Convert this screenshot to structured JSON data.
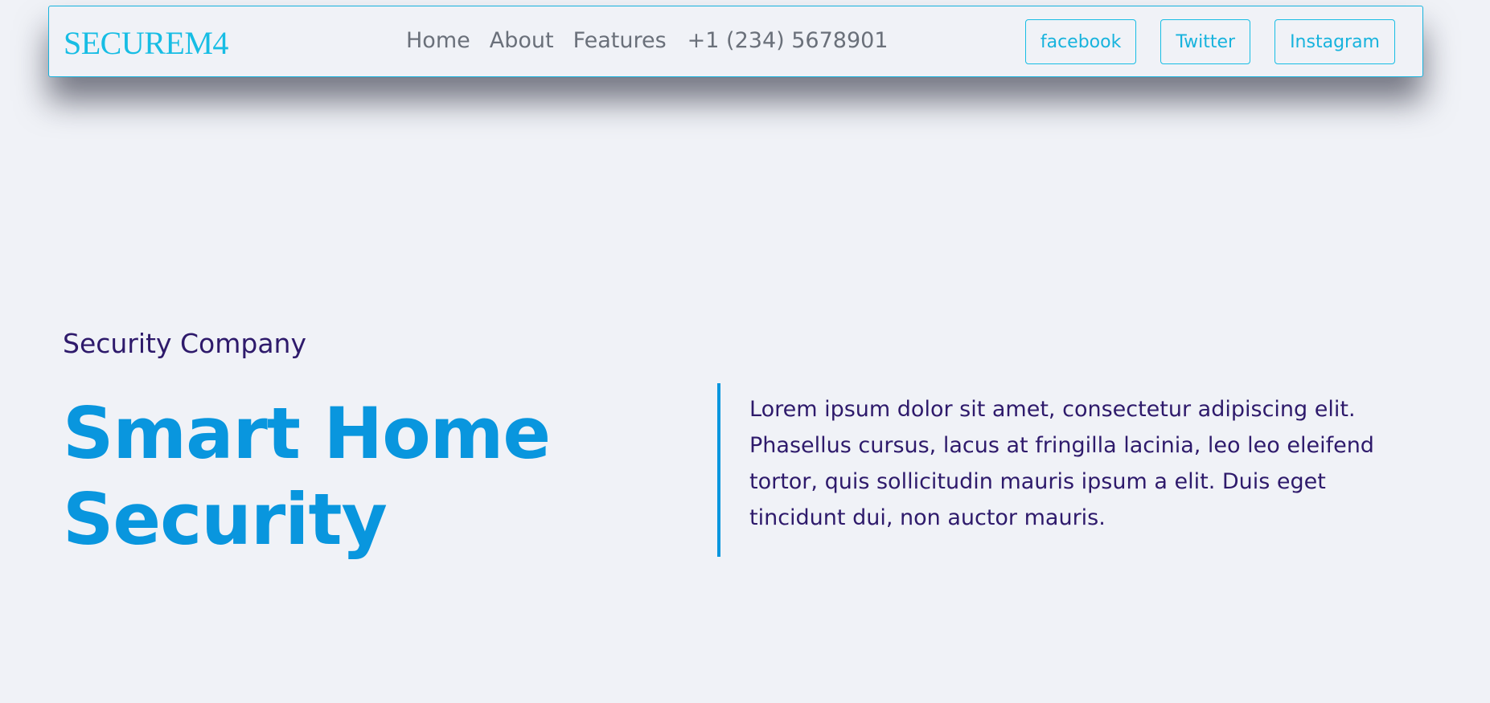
{
  "header": {
    "brand": "SECUREM4",
    "nav": [
      "Home",
      "About",
      "Features",
      "+1 (234) 5678901"
    ],
    "social": [
      "facebook",
      "Twitter",
      "Instagram"
    ]
  },
  "hero": {
    "eyebrow": "Security Company",
    "headline_line1": "Smart Home",
    "headline_line2": "Security",
    "description": "Lorem ipsum dolor sit amet, consectetur adipiscing elit. Phasellus cursus, lacus at fringilla lacinia, leo leo eleifend tortor, quis sollicitudin mauris ipsum a elit. Duis eget tincidunt dui, non auctor mauris."
  },
  "colors": {
    "background": "#f0f2f7",
    "accent": "#17bde4",
    "primary_blue": "#0996de",
    "text_purple": "#2e1a6b",
    "nav_gray": "#6a707a"
  }
}
